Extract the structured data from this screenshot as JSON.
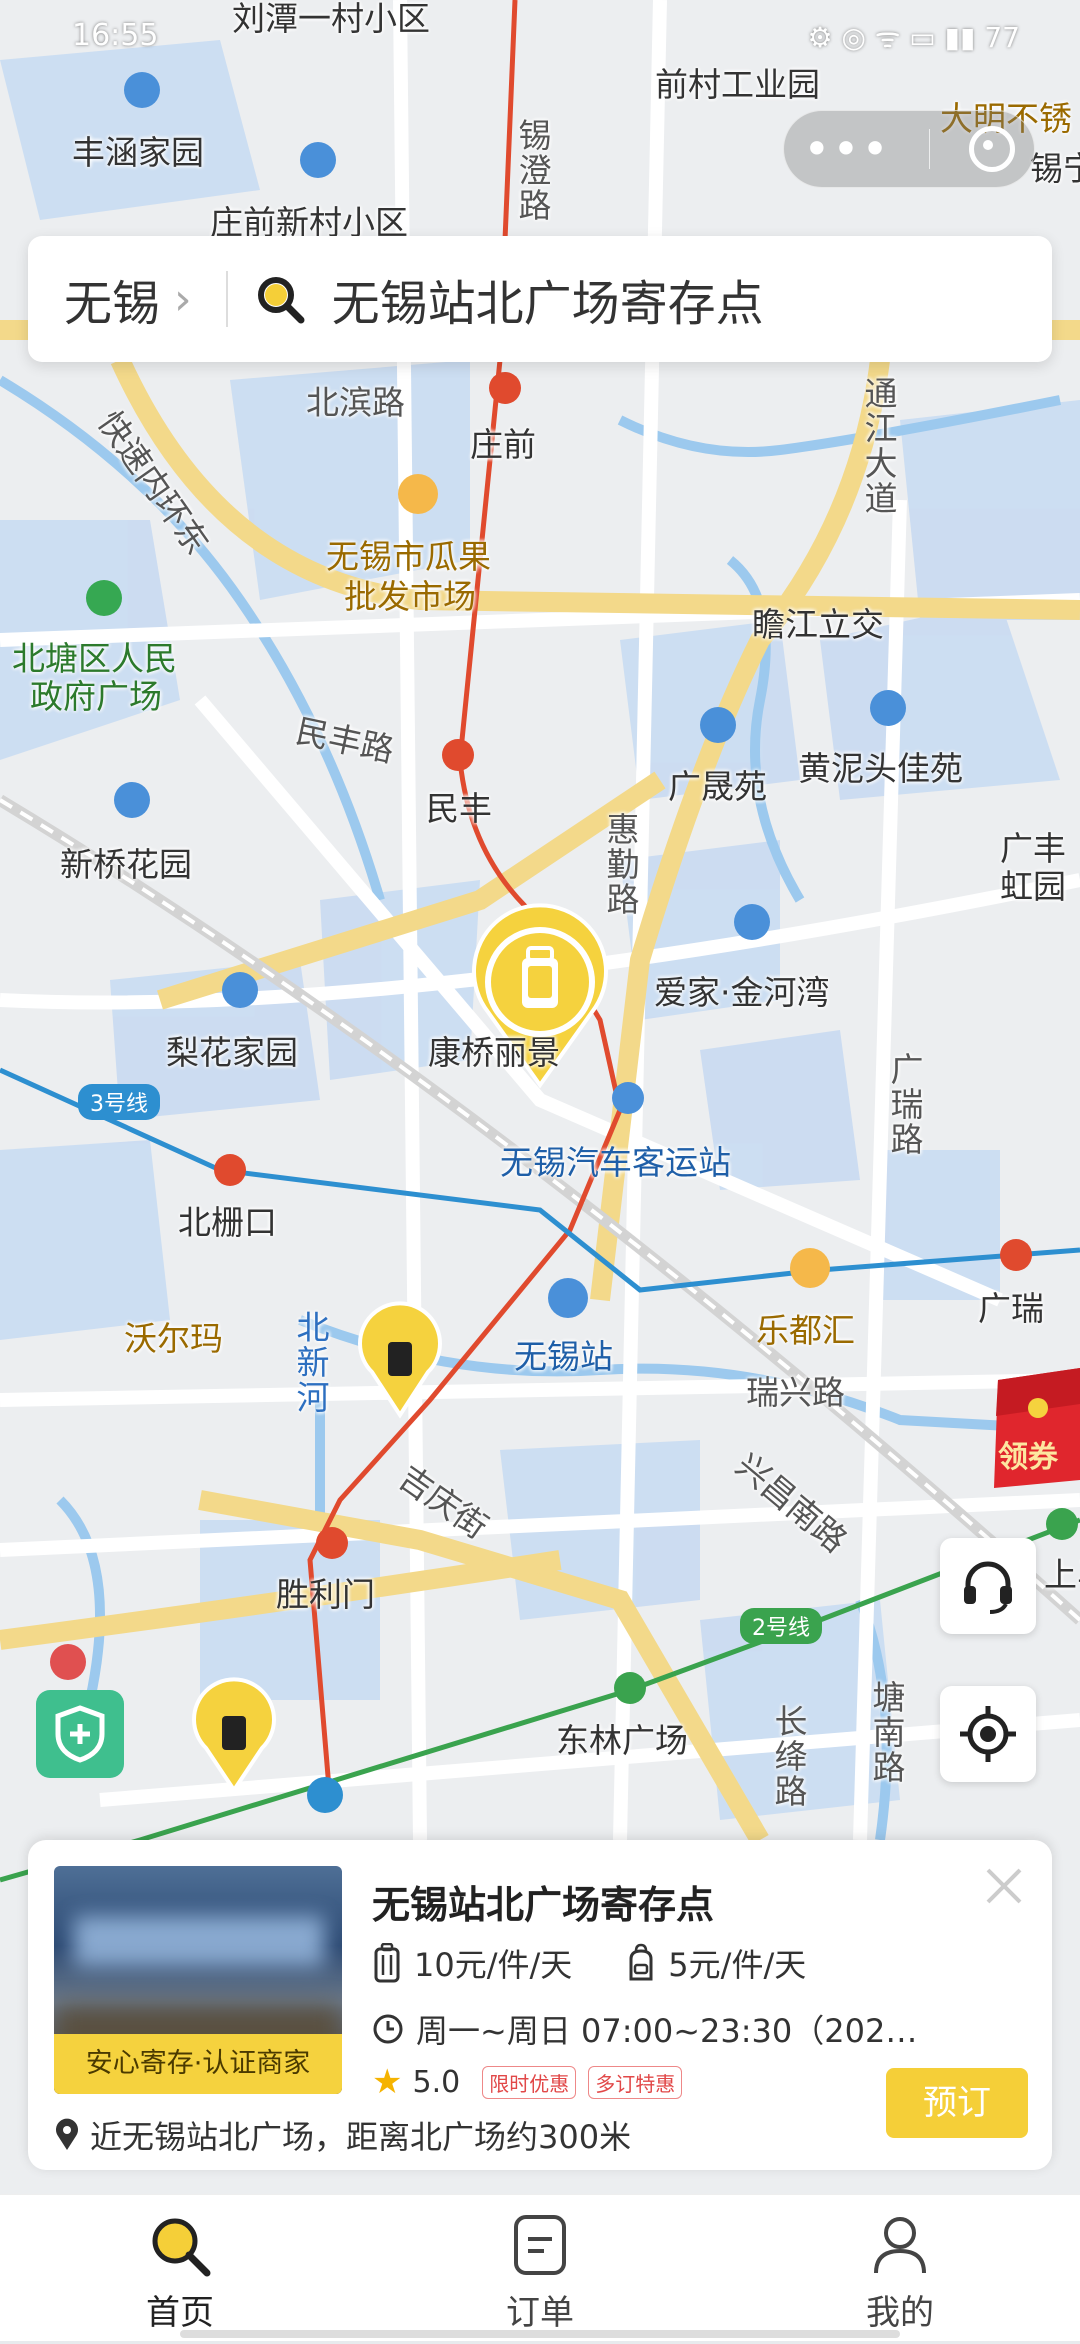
{
  "status_bar": {
    "time": "16:55",
    "icons_text": "⚙ ◎ ᯤ ▭ ▮▮ 77"
  },
  "search_bar": {
    "city": "无锡",
    "query": "无锡站北广场寄存点"
  },
  "map": {
    "labels": [
      {
        "text": "刘潭一村小区",
        "style": ""
      },
      {
        "text": "前村工业园",
        "style": ""
      },
      {
        "text": "大明不锈",
        "style": "orange"
      },
      {
        "text": "锡宁",
        "style": ""
      },
      {
        "text": "丰涵家园",
        "style": ""
      },
      {
        "text": "庄前新村小区",
        "style": ""
      },
      {
        "text": "锡澄路",
        "style": "road vert"
      },
      {
        "text": "北滨路",
        "style": "road"
      },
      {
        "text": "庄前",
        "style": ""
      },
      {
        "text": "快速内环东",
        "style": "road"
      },
      {
        "text": "通江大道",
        "style": "road vert"
      },
      {
        "text": "无锡市瓜果",
        "style": "orange"
      },
      {
        "text": "批发市场",
        "style": "orange"
      },
      {
        "text": "北塘区人民",
        "style": "green"
      },
      {
        "text": "政府广场",
        "style": "green"
      },
      {
        "text": "瞻江立交",
        "style": ""
      },
      {
        "text": "民丰路",
        "style": "road"
      },
      {
        "text": "广晟苑",
        "style": ""
      },
      {
        "text": "黄泥头佳苑",
        "style": ""
      },
      {
        "text": "民丰",
        "style": ""
      },
      {
        "text": "新桥花园",
        "style": ""
      },
      {
        "text": "惠勤路",
        "style": "road vert"
      },
      {
        "text": "广丰",
        "style": ""
      },
      {
        "text": "虹园",
        "style": ""
      },
      {
        "text": "爱家·金河湾",
        "style": ""
      },
      {
        "text": "梨花家园",
        "style": ""
      },
      {
        "text": "康桥丽景",
        "style": ""
      },
      {
        "text": "3号线",
        "style": "line"
      },
      {
        "text": "广瑞路",
        "style": "road vert"
      },
      {
        "text": "无锡汽车客运站",
        "style": ""
      },
      {
        "text": "北栅口",
        "style": ""
      },
      {
        "text": "沃尔玛",
        "style": "orange"
      },
      {
        "text": "北新河",
        "style": "road vert"
      },
      {
        "text": "无锡站",
        "style": ""
      },
      {
        "text": "乐都汇",
        "style": "orange"
      },
      {
        "text": "广瑞",
        "style": ""
      },
      {
        "text": "瑞兴路",
        "style": "road"
      },
      {
        "text": "兴昌南路",
        "style": "road"
      },
      {
        "text": "吉庆街",
        "style": "road"
      },
      {
        "text": "胜利门",
        "style": ""
      },
      {
        "text": "2号线",
        "style": "line"
      },
      {
        "text": "东林广场",
        "style": ""
      },
      {
        "text": "长绛路",
        "style": "road vert"
      },
      {
        "text": "塘南路",
        "style": "road vert"
      },
      {
        "text": "上马",
        "style": ""
      }
    ]
  },
  "coupon": {
    "label": "领券"
  },
  "card": {
    "store_name": "无锡站北广场寄存点",
    "photo_badge": "安心寄存·认证商家",
    "price_large": "10元/件/天",
    "price_small": "5元/件/天",
    "hours": "周一~周日 07:00~23:30（202…",
    "rating": "5.0",
    "tags": [
      "限时优惠",
      "多订特惠"
    ],
    "location": "近无锡站北广场，距离北广场约300米",
    "book_label": "预订"
  },
  "nav": {
    "items": [
      {
        "label": "首页"
      },
      {
        "label": "订单"
      },
      {
        "label": "我的"
      }
    ]
  },
  "colors": {
    "accent": "#f5cf38",
    "metro_line_1": "#e04a2e",
    "metro_line_3": "#2d8fd0",
    "metro_line_2": "#3aa34e"
  }
}
